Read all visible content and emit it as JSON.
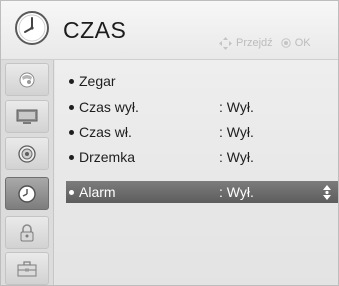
{
  "header": {
    "title": "CZAS",
    "icon": "clock-icon",
    "hint": {
      "move_icon": "four-way-arrows-icon",
      "move_label": "Przejdź",
      "ok_icon": "ok-button-icon",
      "ok_label": "OK"
    }
  },
  "sidebar": {
    "items": [
      {
        "icon": "picture-icon",
        "active": false
      },
      {
        "icon": "monitor-icon",
        "active": false
      },
      {
        "icon": "speaker-icon",
        "active": false
      },
      {
        "icon": "clock-icon",
        "active": true
      },
      {
        "icon": "lock-icon",
        "active": false
      },
      {
        "icon": "toolbox-icon",
        "active": false
      }
    ]
  },
  "menu": {
    "items": [
      {
        "label": "Zegar",
        "value": ""
      },
      {
        "label": "Czas wył.",
        "value": ": Wył."
      },
      {
        "label": "Czas wł.",
        "value": ": Wył."
      },
      {
        "label": "Drzemka",
        "value": ": Wył."
      },
      {
        "label": "Alarm",
        "value": ": Wył.",
        "selected": true
      }
    ]
  },
  "colors": {
    "selected_row": "#6d6d6d",
    "hint_text": "#bcbcbc",
    "title_text": "#1c1c1c"
  }
}
